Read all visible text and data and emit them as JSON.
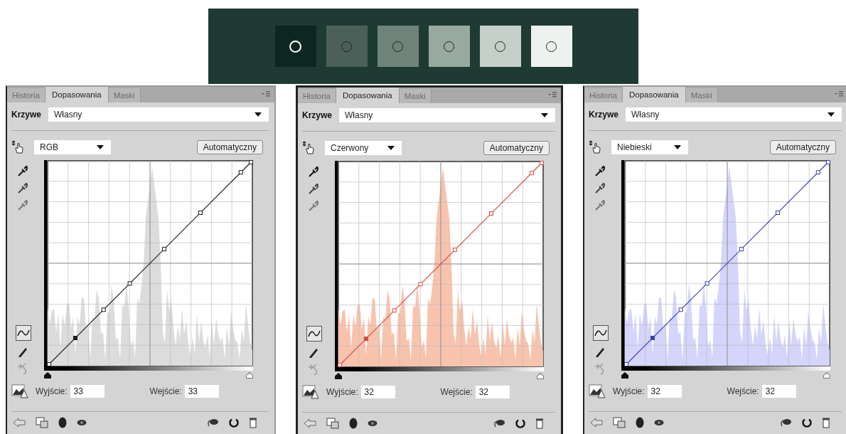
{
  "swatches": [
    {
      "color": "#0e2620",
      "kind": "light"
    },
    {
      "color": "#4b6058",
      "kind": "dark"
    },
    {
      "color": "#6f837a",
      "kind": "dark"
    },
    {
      "color": "#98a99f",
      "kind": "dark"
    },
    {
      "color": "#c4d0c9",
      "kind": "dark"
    },
    {
      "color": "#eef2ef",
      "kind": "dark"
    }
  ],
  "panels": [
    {
      "tabs": [
        {
          "label": "Historia",
          "selected": false
        },
        {
          "label": "Dopasowania",
          "selected": true
        },
        {
          "label": "Maski",
          "selected": false
        }
      ],
      "preset_label": "Krzywe",
      "preset": "Własny",
      "channel": "RGB",
      "auto_button": "Automatyczny",
      "color": "#1a1a1a",
      "histogram": {
        "color": "#dcdcdc"
      },
      "shadow_slider": {
        "level": 0
      },
      "highlight_slider": {
        "level": 1
      },
      "output_label": "Wyjście:",
      "output": "33",
      "input_label": "Wejście:",
      "input": "33"
    },
    {
      "tabs": [
        {
          "label": "Historia",
          "selected": false
        },
        {
          "label": "Dopasowania",
          "selected": true
        },
        {
          "label": "Maski",
          "selected": false
        }
      ],
      "preset_label": "Krzywe",
      "preset": "Własny",
      "channel": "Czerwony",
      "auto_button": "Automatyczny",
      "color": "#d9473f",
      "histogram": {
        "color": "#f8c3ad"
      },
      "shadow_slider": {
        "level": 0
      },
      "highlight_slider": {
        "level": 1
      },
      "output_label": "Wyjście:",
      "output": "32",
      "input_label": "Wejście:",
      "input": "32"
    },
    {
      "tabs": [
        {
          "label": "Historia",
          "selected": false
        },
        {
          "label": "Dopasowania",
          "selected": true
        },
        {
          "label": "Maski",
          "selected": false
        }
      ],
      "preset_label": "Krzywe",
      "preset": "Własny",
      "channel": "Niebieski",
      "auto_button": "Automatyczny",
      "color": "#3b3fb0",
      "histogram": {
        "color": "#d3d5fb"
      },
      "shadow_slider": {
        "level": 0
      },
      "highlight_slider": {
        "level": 1
      },
      "output_label": "Wyjście:",
      "output": "32",
      "input_label": "Wejście:",
      "input": "32"
    }
  ]
}
